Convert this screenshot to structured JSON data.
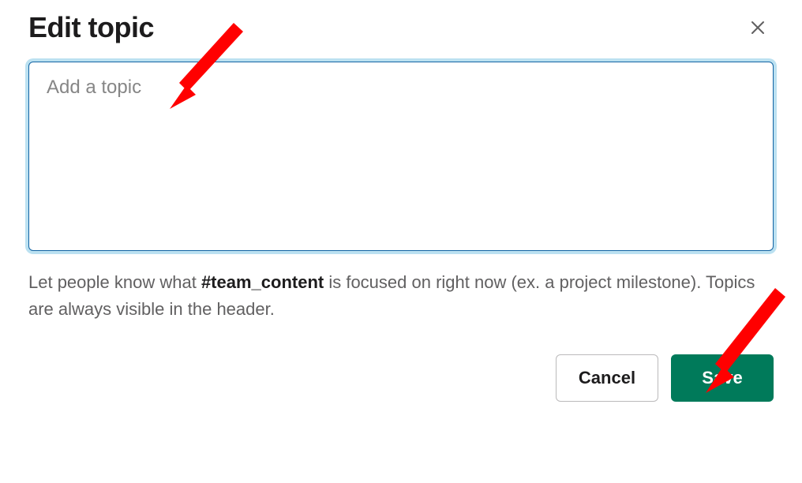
{
  "dialog": {
    "title": "Edit topic",
    "topic_placeholder": "Add a topic",
    "topic_value": "",
    "helper_prefix": "Let people know what ",
    "helper_channel": "#team_content",
    "helper_suffix": " is focused on right now (ex. a project milestone). Topics are always visible in the header.",
    "cancel_label": "Cancel",
    "save_label": "Save"
  }
}
